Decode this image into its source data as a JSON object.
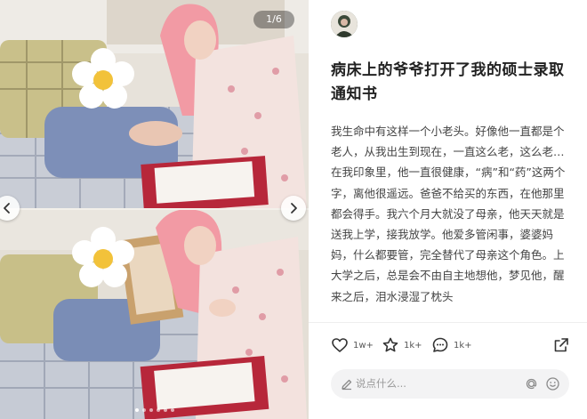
{
  "media": {
    "counter": "1/6",
    "dot_count": 6,
    "active_dot": 1
  },
  "post": {
    "title": "病床上的爷爷打开了我的硕士录取通知书",
    "body": "我生命中有这样一个小老头。好像他一直都是个老人，从我出生到现在，一直这么老，这么老…在我印象里，他一直很健康，“病”和“药”这两个字，离他很遥远。爸爸不给买的东西，在他那里都会得手。我六个月大就没了母亲，他天天就是送我上学，接我放学。他爱多管闲事，婆婆妈妈，什么都要管，完全替代了母亲这个角色。上大学之后，总是会不由自主地想他，梦见他，醒来之后，泪水浸湿了枕头"
  },
  "actions": {
    "like_count": "1w+",
    "fav_count": "1k+",
    "comment_count": "1k+"
  },
  "comment_input": {
    "placeholder": "说点什么..."
  },
  "icons": [
    "chevron-left-icon",
    "chevron-right-icon",
    "heart-icon",
    "star-icon",
    "comment-icon",
    "share-icon",
    "pen-icon",
    "at-icon",
    "emoji-icon"
  ],
  "colors": {
    "text_primary": "#222222",
    "text_body": "#444444",
    "placeholder": "#9a9a9a",
    "input_bg": "#f3f3f4"
  }
}
